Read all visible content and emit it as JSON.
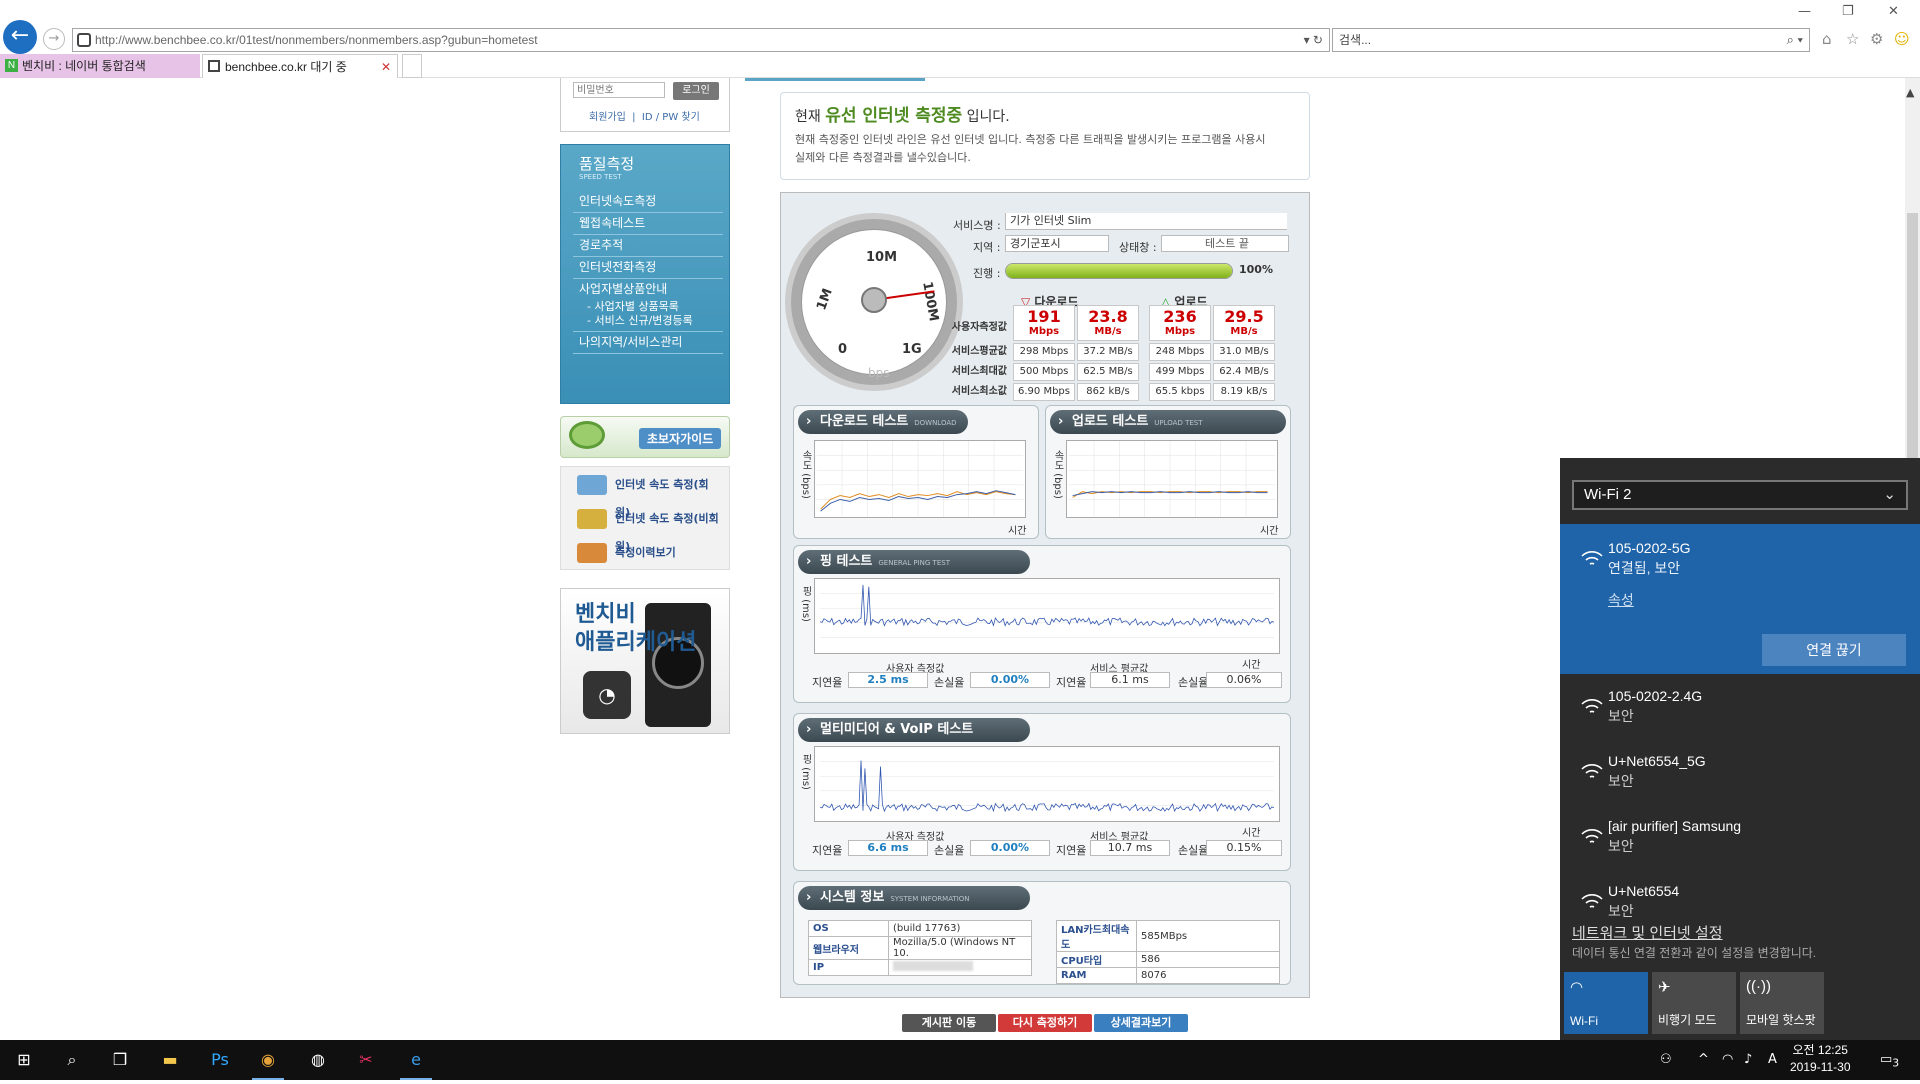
{
  "browser": {
    "url": "http://www.benchbee.co.kr/01test/nonmembers/nonmembers.asp?gubun=hometest",
    "search_placeholder": "검색...",
    "tabs": [
      {
        "label": "벤치비 : 네이버 통합검색"
      },
      {
        "label": "benchbee.co.kr 대기 중"
      }
    ]
  },
  "login": {
    "password_placeholder": "비밀번호",
    "login_button": "로그인",
    "signup": "회원가입",
    "find": "ID / PW 찾기"
  },
  "menu": {
    "title": "품질측정",
    "subtitle": "SPEED TEST",
    "items": [
      "인터넷속도측정",
      "웹접속테스트",
      "경로추적",
      "인터넷전화측정",
      "사업자별상품안내"
    ],
    "subitems": [
      "- 사업자별 상품목록",
      "- 서비스 신규/변경등록"
    ],
    "last_item": "나의지역/서비스관리"
  },
  "beginner_guide": "초보자가이드",
  "quick_links": [
    "인터넷 속도 측정(회원)",
    "인터넷 속도 측정(비회원)",
    "측정이력보기"
  ],
  "app_banner": {
    "line1": "벤치비",
    "line2": "애플리케이션",
    "brand": "BENCHBEE"
  },
  "notice": {
    "prefix": "현재",
    "highlight": "유선 인터넷 측정중",
    "suffix": "입니다.",
    "line1": "현재 측정중인 인터넷 라인은 유선 인터넷 입니다. 측정중 다른 트래픽을 발생시키는 프로그램을 사용시",
    "line2": "실제와 다른 측정결과를 낼수있습니다."
  },
  "gauge": {
    "labels": [
      "10M",
      "1M",
      "100M",
      "0",
      "1G"
    ],
    "unit": "bps"
  },
  "service": {
    "name_label": "서비스명",
    "name_value": "기가 인터넷 Slim",
    "region_label": "지역",
    "region_value": "경기군포시",
    "status_label": "상태창",
    "status_value": "테스트 끝",
    "progress_label": "진행",
    "progress_pct": "100%",
    "progress_fraction": 1.0
  },
  "results": {
    "download_head": "다운로드",
    "upload_head": "업로드",
    "row_labels": [
      "사용자측정값",
      "서비스평균값",
      "서비스최대값",
      "서비스최소값"
    ],
    "user_values": [
      {
        "v": "191",
        "u": "Mbps"
      },
      {
        "v": "23.8",
        "u": "MB/s"
      },
      {
        "v": "236",
        "u": "Mbps"
      },
      {
        "v": "29.5",
        "u": "MB/s"
      }
    ],
    "rows": [
      [
        "298 Mbps",
        "37.2 MB/s",
        "248 Mbps",
        "31.0 MB/s"
      ],
      [
        "500 Mbps",
        "62.5 MB/s",
        "499 Mbps",
        "62.4 MB/s"
      ],
      [
        "6.90 Mbps",
        "862 kB/s",
        "65.5 kbps",
        "8.19 kB/s"
      ]
    ]
  },
  "download_test": {
    "title": "다운로드 테스트",
    "en": "DOWNLOAD TEST",
    "ylabel": "속도 (bps)",
    "xlabel": "시간"
  },
  "upload_test": {
    "title": "업로드 테스트",
    "en": "UPLOAD TEST",
    "ylabel": "속도 (bps)",
    "xlabel": "시간"
  },
  "ping_test": {
    "title": "핑 테스트",
    "en": "GENERAL PING TEST",
    "ylabel": "핑 (ms)",
    "xlabel": "시간",
    "user_label": "사용자 측정값",
    "service_label": "서비스 평균값",
    "latency_label": "지연율",
    "loss_label": "손실율",
    "user_latency": "2.5 ms",
    "user_loss": "0.00%",
    "service_latency": "6.1 ms",
    "service_loss": "0.06%"
  },
  "voip_test": {
    "title": "멀티미디어 & VoIP 테스트",
    "ylabel": "핑 (ms)",
    "xlabel": "시간",
    "user_label": "사용자 측정값",
    "service_label": "서비스 평균값",
    "latency_label": "지연율",
    "loss_label": "손실율",
    "user_latency": "6.6 ms",
    "user_loss": "0.00%",
    "service_latency": "10.7 ms",
    "service_loss": "0.15%"
  },
  "system_info": {
    "title": "시스템 정보",
    "en": "SYSTEM INFORMATION",
    "left": [
      {
        "k": "OS",
        "v": "(build 17763)"
      },
      {
        "k": "웹브라우저",
        "v": "Mozilla/5.0 (Windows NT 10."
      },
      {
        "k": "IP",
        "v": ""
      }
    ],
    "right": [
      {
        "k": "LAN카드최대속도",
        "v": "585MBps"
      },
      {
        "k": "CPU타입",
        "v": "586"
      },
      {
        "k": "RAM",
        "v": "8076"
      }
    ]
  },
  "bottom_buttons": [
    "게시판 이동",
    "다시 측정하기",
    "상세결과보기"
  ],
  "wifi": {
    "adapter": "Wi-Fi 2",
    "connected": {
      "name": "105-0202-5G",
      "status": "연결됨, 보안",
      "properties": "속성",
      "disconnect": "연결 끊기"
    },
    "networks": [
      {
        "name": "105-0202-2.4G",
        "status": "보안"
      },
      {
        "name": "U+Net6554_5G",
        "status": "보안"
      },
      {
        "name": "[air purifier] Samsung",
        "status": "보안"
      },
      {
        "name": "U+Net6554",
        "status": "보안"
      }
    ],
    "settings_link": "네트워크 및 인터넷 설정",
    "settings_desc": "데이터 통신 연결 전환과 같이 설정을 변경합니다.",
    "quick_actions": [
      {
        "label": "Wi-Fi",
        "icon": "wifi-icon"
      },
      {
        "label": "비행기 모드",
        "icon": "airplane-icon"
      },
      {
        "label": "모바일 핫스팟",
        "icon": "hotspot-icon"
      }
    ]
  },
  "taskbar": {
    "time": "오전 12:25",
    "date": "2019-11-30",
    "ime": "A",
    "notifications": "3"
  }
}
